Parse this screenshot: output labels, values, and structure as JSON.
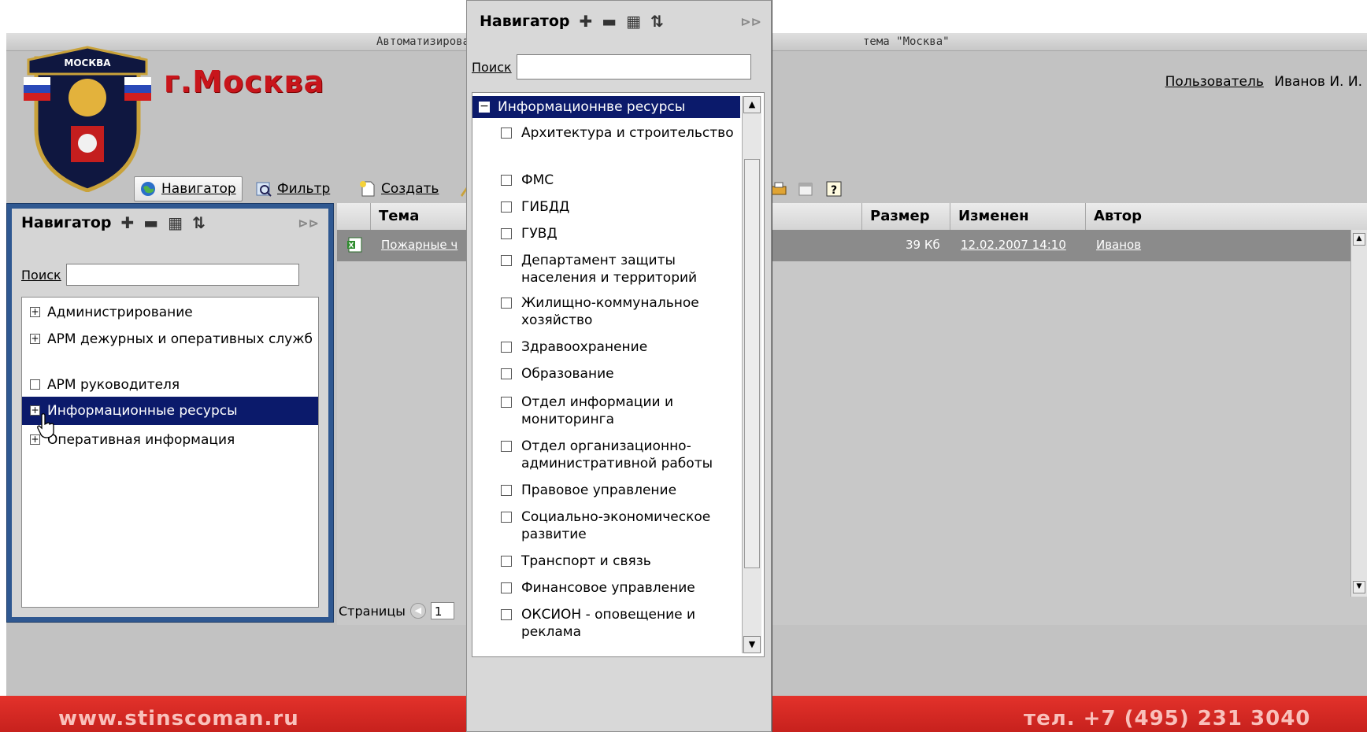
{
  "window": {
    "title_left": "Автоматизирова",
    "title_right": "тема \"Москва\""
  },
  "header": {
    "city": "г.Москва",
    "user_label": "Пользователь",
    "user_name": "Иванов И. И."
  },
  "toolbar": {
    "navigator_label": "Навигатор",
    "filter_label": "Фильтр",
    "create_label": "Создать"
  },
  "navigator": {
    "title": "Навигатор",
    "search_label": "Поиск",
    "search_value": "",
    "items": [
      {
        "label": "Администрирование",
        "state": "+"
      },
      {
        "label": "АРМ дежурных и оперативных служб",
        "state": "+"
      },
      {
        "label": "АРМ руководителя",
        "state": ""
      },
      {
        "label": "Информационные ресурсы",
        "state": "+",
        "selected": true
      },
      {
        "label": "Оперативная информация",
        "state": "+"
      }
    ]
  },
  "grid": {
    "columns": [
      "Тема",
      "Размер",
      "Изменен",
      "Автор"
    ],
    "rows": [
      {
        "topic": "Пожарные ч",
        "size": "39 Кб",
        "modified": "12.02.2007 14:10",
        "author": "Иванов"
      }
    ],
    "pages_label": "Страницы",
    "page_value": "1"
  },
  "popup": {
    "title": "Навигатор",
    "search_label": "Поиск",
    "search_value": "",
    "root_label": "Информационнве ресурсы",
    "items": [
      "Архитектура и строительство",
      "ФМС",
      "ГИБДД",
      "ГУВД",
      "Департамент защиты населения и территорий",
      "Жилищно-коммунальное хозяйство",
      "Здравоохранение",
      "Образование",
      "Отдел информации и мониторинга",
      "Отдел организационно-административной работы",
      "Правовое управление",
      "Социально-экономическое развитие",
      "Транспорт и связь",
      "Финансовое управление",
      "ОКСИОН - оповещение и реклама"
    ]
  },
  "footer": {
    "left": "www.stinscoman.ru",
    "right": "тел. +7 (495) 231 3040"
  },
  "colors": {
    "selection": "#0b1a6b",
    "panel_frame": "#2f5891",
    "brand_red": "#c8151b",
    "footer_red": "#d42a24"
  }
}
